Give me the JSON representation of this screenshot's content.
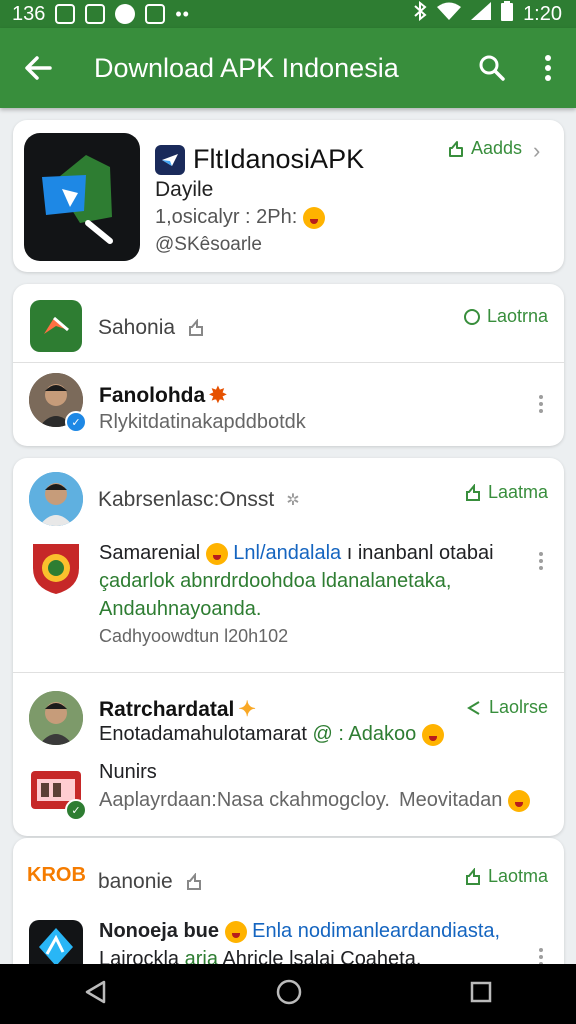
{
  "status_bar": {
    "left_text": "136",
    "time": "1:20"
  },
  "app_bar": {
    "title": "Download APK Indonesia"
  },
  "app_card": {
    "name": "FltIdanosiAPK",
    "subtitle": "Dayile",
    "meta": "1,osicalyr : 2Ph:",
    "publisher": "@SKêsoarle",
    "add_label": "Aadds"
  },
  "card2": {
    "header_label": "Sahonia",
    "header_action": "Laotrna",
    "post_name": "Fanolohda",
    "post_line": "Rlykitdatinakapddbotdk"
  },
  "card3": {
    "header_label": "Kabrsenlasc:Onsst",
    "header_action": "Laatma",
    "text_line1_a": "Samarenial",
    "text_line1_b": "Lnl/andalala",
    "text_line1_c": "ı inanbanl otabai",
    "text_line2": "çadarlok abnrdrdoohdoa ldanalanetaka,",
    "text_line3": "Andauhnayoanda.",
    "footer": "Cadhyoowdtun l20h102"
  },
  "card3b": {
    "post_name": "Ratrchardatal",
    "post_action": "Laolrse",
    "line1": "Enotadamahulotamarat",
    "line1_mention": "@ : Adakoo",
    "line2": "Nunirs",
    "line3_a": "Aaplayrdaan:Nasa ckahmogcloy.",
    "line3_b": "Meovitadan"
  },
  "card4": {
    "brand": "KROB",
    "header_label": "banonie",
    "header_action": "Laotma",
    "line1_a": "Nonoeja bue",
    "line1_b": "Enla nodimanleardandiasta,",
    "line2_a": "Lairockla",
    "line2_b": "arja",
    "line2_c": "Ahricle lsalai Coaheta."
  },
  "colors": {
    "primary": "#388e3c",
    "status": "#2e7d32",
    "accent_blue": "#1565c0"
  },
  "icons": [
    "arrow-back-icon",
    "search-icon",
    "more-vert-icon",
    "share-icon",
    "chevron-right-icon",
    "back-triangle-icon",
    "home-circle-icon",
    "recents-square-icon"
  ]
}
